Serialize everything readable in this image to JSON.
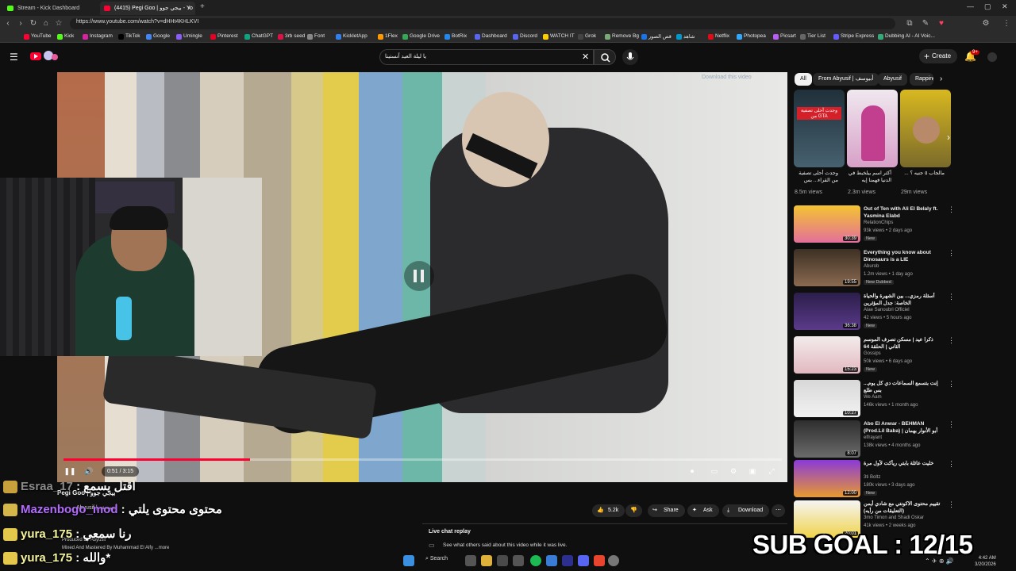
{
  "browser": {
    "tabs": [
      {
        "title": "Stream - Kick Dashboard",
        "active": false
      },
      {
        "title": "(4415) Pegi Goo | بيجي جوو - Yo",
        "active": true
      }
    ],
    "url": "https://www.youtube.com/watch?v=dHHt4KHLKVI",
    "bookmarks": [
      "YouTube",
      "Kick",
      "Instagram",
      "TikTok",
      "Google",
      "Umingle",
      "Pinterest",
      "ChatGPT",
      "3rb seed",
      "Font",
      "KickletApp",
      "1Flex",
      "Google Drive",
      "BotRix",
      "Dashboard",
      "Discord",
      "WATCH IT",
      "Grok",
      "Remove Bg",
      "قص الصور",
      "شاهد",
      "Netflix",
      "Photopea",
      "Picsart",
      "Tier List",
      "Stripe Express",
      "Dubbing AI - AI Voic..."
    ]
  },
  "youtube": {
    "search_query": "يا ليلة العيد آنستينا",
    "create_label": "Create",
    "notif_count": "9+",
    "download_hint": "Download this video"
  },
  "player": {
    "time": "0:51 / 3:15",
    "progress": 0.26
  },
  "below": {
    "likes": "5.2k",
    "share": "Share",
    "ask": "Ask",
    "download": "Download",
    "live_chat_title": "Live chat replay",
    "live_chat_sub": "See what others said about this video while it was live.",
    "desc_title": "Pegi Goo | بيجي جوو",
    "desc_channel": "Abyusif | أبيوسف",
    "desc_produced": "Produced By Abyusif",
    "desc_mixed": "Mixed And Mastered By Muhammad El Alfy ...more"
  },
  "sidebar": {
    "chips": [
      "All",
      "From Abyusif | أبيوسف",
      "Abyusif",
      "Rapping"
    ],
    "shorts": [
      {
        "title": "وجدت أحلى تصفية من القراء... بس",
        "views": "8.5m views",
        "tag": "وجدت أحلى تصفية من GTA"
      },
      {
        "title": "أكثر اسم بيلخبط في الدنيا فهمنا إيه",
        "views": "2.3m views"
      },
      {
        "title": "مالجاب ٥ جنيه ؟ ...",
        "views": "29m views"
      }
    ],
    "videos": [
      {
        "title": "Out of Ten with Ali El Belaly ft. Yasmina Elabd",
        "channel": "RelationChips",
        "views": "93k views • 2 days ago",
        "badge": "New",
        "duration": "30:39"
      },
      {
        "title": "Everything you know about Dinosaurs is a LIE",
        "channel": "Aburob",
        "views": "1.2m views • 1 day ago",
        "badge": "New  Dubbed",
        "duration": "19:55"
      },
      {
        "title": "أسئلة رمزي... بين الشهرة والحياة الخاصة: جدل المؤثرين",
        "channel": "Alae Sanoubri Officiel",
        "views": "42 views • 5 hours ago",
        "badge": "New",
        "duration": "36:38"
      },
      {
        "title": "ذكرا عيد | مسكن تصرف الموسم الثاني | الحلقة 64",
        "channel": "Gossips",
        "views": "50k views • 6 days ago",
        "badge": "New",
        "duration": "15:23"
      },
      {
        "title": "إنت بتسمع السماعات دي كل يوم... بس طلع",
        "channel": "We Aam",
        "views": "146k views • 1 month ago",
        "badge": "",
        "duration": "10:27"
      },
      {
        "title": "Abo El Anwar - BEHMAN (Prod.Lil Baba) | أبو الأنوار بهمان",
        "channel": "elfrayant",
        "views": "138k views • 4 months ago",
        "badge": "",
        "duration": "8:07"
      },
      {
        "title": "خليت عائلة بابتي ريأكت لأول مرة",
        "channel": "3ti Boltz",
        "views": "180k views • 3 days ago",
        "badge": "New",
        "duration": "12:00"
      },
      {
        "title": "تقييم محتوى الاكونتي مع شادي أيمن (التعليقات من رأيه)",
        "channel": "3mo Timon and Shadi Oskar",
        "views": "41k views • 2 weeks ago",
        "badge": "",
        "duration": "20:01"
      }
    ]
  },
  "stream_overlay": {
    "chat": [
      {
        "user": "Esraa_17",
        "text": "اقتل يسمع",
        "color": "#8a8a8a"
      },
      {
        "user": "Mazenbogo_mod",
        "text": "محتوى محتوى يلتي",
        "color": "#b36bff"
      },
      {
        "user": "yura_175",
        "text": "رنا سمعي",
        "color": "#f5f5a0"
      },
      {
        "user": "yura_175",
        "text": "والله*",
        "color": "#f5f5a0"
      }
    ],
    "subgoal": "SUB GOAL : 12/15"
  },
  "system": {
    "taskbar_search": "Search",
    "time": "4:42 AM",
    "date": "3/20/2026"
  },
  "colors": {
    "accent": "#ff0033",
    "bg": "#0f0f0f"
  }
}
